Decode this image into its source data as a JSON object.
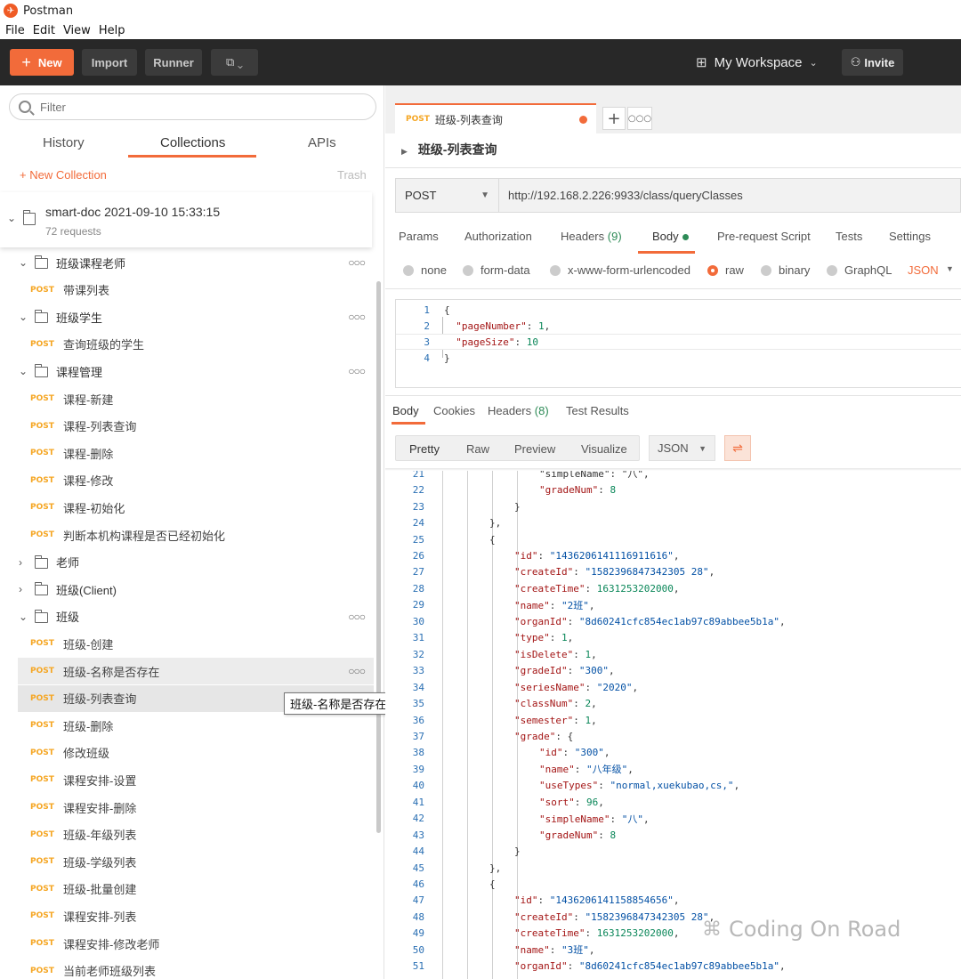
{
  "app": {
    "title": "Postman"
  },
  "menu": [
    "File",
    "Edit",
    "View",
    "Help"
  ],
  "toolbar": {
    "new_label": "New",
    "import_label": "Import",
    "runner_label": "Runner",
    "workspace_label": "My Workspace",
    "invite_label": "Invite"
  },
  "sidebar": {
    "filter_placeholder": "Filter",
    "tabs": [
      "History",
      "Collections",
      "APIs"
    ],
    "active_tab": "Collections",
    "new_collection_label": "+ New Collection",
    "trash_label": "Trash",
    "collection": {
      "name": "smart-doc 2021-09-10 15:33:15",
      "count": "72 requests"
    },
    "tree": [
      {
        "kind": "folder",
        "label": "班级课程老师",
        "expanded": true,
        "dots": true
      },
      {
        "kind": "request",
        "method": "POST",
        "label": "带课列表"
      },
      {
        "kind": "folder",
        "label": "班级学生",
        "expanded": true,
        "dots": true
      },
      {
        "kind": "request",
        "method": "POST",
        "label": "查询班级的学生"
      },
      {
        "kind": "folder",
        "label": "课程管理",
        "expanded": true,
        "dots": true
      },
      {
        "kind": "request",
        "method": "POST",
        "label": "课程-新建"
      },
      {
        "kind": "request",
        "method": "POST",
        "label": "课程-列表查询"
      },
      {
        "kind": "request",
        "method": "POST",
        "label": "课程-删除"
      },
      {
        "kind": "request",
        "method": "POST",
        "label": "课程-修改"
      },
      {
        "kind": "request",
        "method": "POST",
        "label": "课程-初始化"
      },
      {
        "kind": "request",
        "method": "POST",
        "label": "判断本机构课程是否已经初始化"
      },
      {
        "kind": "folder",
        "label": "老师",
        "expanded": false
      },
      {
        "kind": "folder",
        "label": "班级(Client)",
        "expanded": false
      },
      {
        "kind": "folder",
        "label": "班级",
        "expanded": true,
        "dots": true
      },
      {
        "kind": "request",
        "method": "POST",
        "label": "班级-创建"
      },
      {
        "kind": "request",
        "method": "POST",
        "label": "班级-名称是否存在",
        "state": "hover",
        "dots": true
      },
      {
        "kind": "request",
        "method": "POST",
        "label": "班级-列表查询",
        "state": "selected"
      },
      {
        "kind": "request",
        "method": "POST",
        "label": "班级-删除"
      },
      {
        "kind": "request",
        "method": "POST",
        "label": "修改班级"
      },
      {
        "kind": "request",
        "method": "POST",
        "label": "课程安排-设置"
      },
      {
        "kind": "request",
        "method": "POST",
        "label": "课程安排-删除"
      },
      {
        "kind": "request",
        "method": "POST",
        "label": "班级-年级列表"
      },
      {
        "kind": "request",
        "method": "POST",
        "label": "班级-学级列表"
      },
      {
        "kind": "request",
        "method": "POST",
        "label": "班级-批量创建"
      },
      {
        "kind": "request",
        "method": "POST",
        "label": "课程安排-列表"
      },
      {
        "kind": "request",
        "method": "POST",
        "label": "课程安排-修改老师"
      },
      {
        "kind": "request",
        "method": "POST",
        "label": "当前老师班级列表"
      }
    ],
    "tooltip": "班级-名称是否存在"
  },
  "request": {
    "tab_method": "POST",
    "tab_name": "班级-列表查询",
    "breadcrumb": "班级-列表查询",
    "method": "POST",
    "url": "http://192.168.2.226:9933/class/queryClasses",
    "tabs": [
      {
        "label": "Params"
      },
      {
        "label": "Authorization"
      },
      {
        "label": "Headers",
        "count": "(9)"
      },
      {
        "label": "Body",
        "active": true
      },
      {
        "label": "Pre-request Script"
      },
      {
        "label": "Tests"
      },
      {
        "label": "Settings"
      }
    ],
    "body_modes": [
      "none",
      "form-data",
      "x-www-form-urlencoded",
      "raw",
      "binary",
      "GraphQL"
    ],
    "body_mode_selected": "raw",
    "body_format": "JSON",
    "body_lines": [
      {
        "n": "1",
        "text": "{"
      },
      {
        "n": "2",
        "key": "pageNumber",
        "val": "1"
      },
      {
        "n": "3",
        "key": "pageSize",
        "val": "10"
      },
      {
        "n": "4",
        "text": "}"
      }
    ]
  },
  "response": {
    "tabs": [
      {
        "label": "Body",
        "active": true
      },
      {
        "label": "Cookies"
      },
      {
        "label": "Headers",
        "count": "(8)"
      },
      {
        "label": "Test Results"
      }
    ],
    "view_modes": [
      "Pretty",
      "Raw",
      "Preview",
      "Visualize"
    ],
    "view_active": "Pretty",
    "format": "JSON",
    "lines": [
      {
        "n": "21",
        "indent": 4,
        "raw": "\"simpleName\": \"八\","
      },
      {
        "n": "22",
        "indent": 4,
        "key": "gradeNum",
        "num": "8"
      },
      {
        "n": "23",
        "indent": 3,
        "raw": "}"
      },
      {
        "n": "24",
        "indent": 2,
        "raw": "},"
      },
      {
        "n": "25",
        "indent": 2,
        "raw": "{"
      },
      {
        "n": "26",
        "indent": 3,
        "key": "id",
        "str": "1436206141116911616",
        "comma": true
      },
      {
        "n": "27",
        "indent": 3,
        "key": "createId",
        "str": "1582396847342305 28",
        "comma": true
      },
      {
        "n": "28",
        "indent": 3,
        "key": "createTime",
        "num": "1631253202000",
        "comma": true
      },
      {
        "n": "29",
        "indent": 3,
        "key": "name",
        "str": "2班",
        "comma": true
      },
      {
        "n": "30",
        "indent": 3,
        "key": "organId",
        "str": "8d60241cfc854ec1ab97c89abbee5b1a",
        "comma": true
      },
      {
        "n": "31",
        "indent": 3,
        "key": "type",
        "num": "1",
        "comma": true
      },
      {
        "n": "32",
        "indent": 3,
        "key": "isDelete",
        "num": "1",
        "comma": true
      },
      {
        "n": "33",
        "indent": 3,
        "key": "gradeId",
        "str": "300",
        "comma": true
      },
      {
        "n": "34",
        "indent": 3,
        "key": "seriesName",
        "str": "2020",
        "comma": true
      },
      {
        "n": "35",
        "indent": 3,
        "key": "classNum",
        "num": "2",
        "comma": true
      },
      {
        "n": "36",
        "indent": 3,
        "key": "semester",
        "num": "1",
        "comma": true
      },
      {
        "n": "37",
        "indent": 3,
        "key": "grade",
        "open": "{"
      },
      {
        "n": "38",
        "indent": 4,
        "key": "id",
        "str": "300",
        "comma": true
      },
      {
        "n": "39",
        "indent": 4,
        "key": "name",
        "str": "八年级",
        "comma": true
      },
      {
        "n": "40",
        "indent": 4,
        "key": "useTypes",
        "str": "normal,xuekubao,cs,",
        "comma": true
      },
      {
        "n": "41",
        "indent": 4,
        "key": "sort",
        "num": "96",
        "comma": true
      },
      {
        "n": "42",
        "indent": 4,
        "key": "simpleName",
        "str": "八",
        "comma": true
      },
      {
        "n": "43",
        "indent": 4,
        "key": "gradeNum",
        "num": "8"
      },
      {
        "n": "44",
        "indent": 3,
        "raw": "}"
      },
      {
        "n": "45",
        "indent": 2,
        "raw": "},"
      },
      {
        "n": "46",
        "indent": 2,
        "raw": "{"
      },
      {
        "n": "47",
        "indent": 3,
        "key": "id",
        "str": "1436206141158854656",
        "comma": true
      },
      {
        "n": "48",
        "indent": 3,
        "key": "createId",
        "str": "1582396847342305 28",
        "comma": true
      },
      {
        "n": "49",
        "indent": 3,
        "key": "createTime",
        "num": "1631253202000",
        "comma": true
      },
      {
        "n": "50",
        "indent": 3,
        "key": "name",
        "str": "3班",
        "comma": true
      },
      {
        "n": "51",
        "indent": 3,
        "key": "organId",
        "str": "8d60241cfc854ec1ab97c89abbee5b1a",
        "comma": true
      }
    ]
  },
  "watermark": "Coding On Road",
  "colors": {
    "accent": "#f26b3a",
    "post": "#f5a623",
    "toolbar": "#282828",
    "key": "#a31515",
    "string": "#0451a5",
    "number": "#098658"
  }
}
